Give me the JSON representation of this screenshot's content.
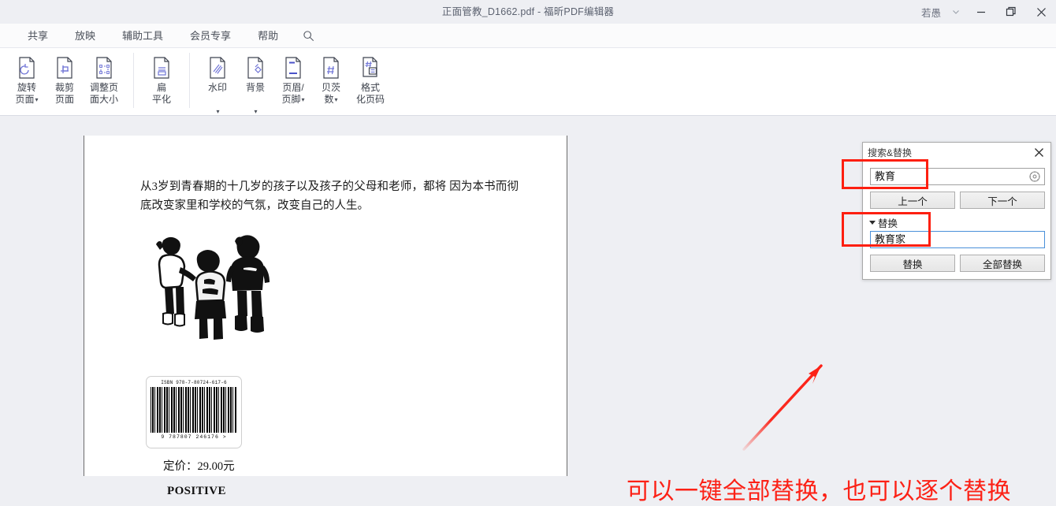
{
  "window": {
    "title": "正面管教_D1662.pdf - 福昕PDF编辑器",
    "user": "若愚",
    "controls": {
      "chevron": "chevron-down",
      "minimize": "minimize",
      "restore": "restore",
      "close": "close"
    }
  },
  "menubar": {
    "items": [
      {
        "label": "共享"
      },
      {
        "label": "放映"
      },
      {
        "label": "辅助工具"
      },
      {
        "label": "会员专享"
      },
      {
        "label": "帮助"
      }
    ],
    "search_icon": "search-icon"
  },
  "ribbon": {
    "groups": [
      {
        "buttons": [
          {
            "label": "旋转\n页面",
            "icon": "rotate-page-icon",
            "caret": true
          },
          {
            "label": "裁剪\n页面",
            "icon": "crop-page-icon",
            "caret": false
          },
          {
            "label": "调整页\n面大小",
            "icon": "resize-page-icon",
            "caret": false
          }
        ]
      },
      {
        "buttons": [
          {
            "label": "扁\n平化",
            "icon": "flatten-icon",
            "caret": false
          }
        ]
      },
      {
        "buttons": [
          {
            "label": "水印\n",
            "icon": "watermark-icon",
            "caret": true
          },
          {
            "label": "背景\n",
            "icon": "background-icon",
            "caret": true
          },
          {
            "label": "页眉/\n页脚",
            "icon": "header-footer-icon",
            "caret": true
          },
          {
            "label": "贝茨\n数",
            "icon": "bates-number-icon",
            "caret": true
          },
          {
            "label": "格式\n化页码",
            "icon": "format-page-number-icon",
            "caret": false
          }
        ]
      }
    ]
  },
  "document": {
    "paragraph": "从3岁到青春期的十几岁的孩子以及孩子的父母和老师，都将 因为本书而彻底改变家里和学校的气氛，改变自己的人生。",
    "photo_alt": "三个孩子的黑白照片",
    "barcode": {
      "isbn": "ISBN 978-7-80724-617-6",
      "number": "9 787807 246176 >"
    },
    "price": "定价：29.00元",
    "footer": "POSITIVE"
  },
  "annotation": {
    "text": "可以一键全部替换，也可以逐个替换",
    "color": "#fc2116",
    "arrow": "arrow-pointing-to-replace-field"
  },
  "dialog": {
    "title": "搜索&替换",
    "close_icon": "close-icon",
    "search": {
      "value": "教育",
      "placeholder": "",
      "settings_icon": "gear-icon"
    },
    "buttons": {
      "previous": "上一个",
      "next": "下一个",
      "replace": "替换",
      "replace_all": "全部替换"
    },
    "replace_section": {
      "header": "替换",
      "expanded": true,
      "value": "教育家",
      "placeholder": ""
    }
  },
  "highlights": {
    "accent": "#fd1f10",
    "count": 2
  }
}
